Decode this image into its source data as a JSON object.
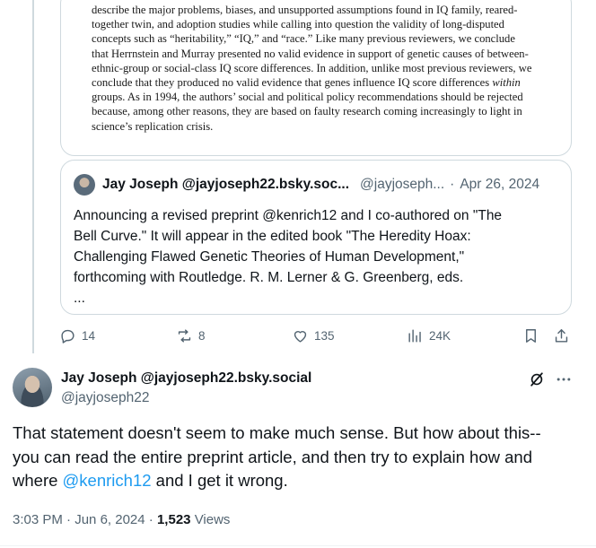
{
  "image_card": {
    "lines": [
      "describe the major problems, biases, and unsupported assumptions found in IQ family, reared-",
      "together twin, and adoption studies while calling into question the validity of long-disputed",
      "concepts such as “heritability,” “IQ,” and “race.” Like many previous reviewers, we conclude",
      "that Herrnstein and Murray presented no valid evidence in support of genetic causes of between-",
      "ethnic-group or social-class IQ score differences. In addition, unlike most previous reviewers, we",
      "conclude that they produced no valid evidence that genes influence IQ score differences",
      "groups. As in 1994, the authors’ social and political policy recommendations should be rejected",
      "because, among other reasons, they are based on faulty research coming increasingly to light in",
      "science’s replication crisis."
    ],
    "italic_word": "within"
  },
  "quote": {
    "author_name": "Jay Joseph @jayjoseph22.bsky.soc...",
    "author_handle": "@jayjoseph...",
    "separator": "·",
    "date": "Apr 26, 2024",
    "body_lines": [
      "Announcing a revised preprint @kenrich12 and I co-authored on \"The",
      "Bell Curve.\" It will appear in the edited book \"The Heredity Hoax:",
      "Challenging Flawed Genetic Theories of Human Development,\"",
      "forthcoming with Routledge. R. M. Lerner & G. Greenberg, eds.",
      "..."
    ]
  },
  "actions": {
    "replies": "14",
    "reposts": "8",
    "likes": "135",
    "views": "24K"
  },
  "post": {
    "author_name": "Jay Joseph @jayjoseph22.bsky.social",
    "author_handle": "@jayjoseph22",
    "text_line1": "That statement doesn't seem to make much sense. But how about this--",
    "text_line2": "you can read the entire preprint article, and then try to explain how and",
    "text_line3_pre": "where ",
    "mention": "@kenrich12",
    "text_line3_post": " and I get it wrong.",
    "time": "3:03 PM",
    "date_sep": "·",
    "date": "Jun 6, 2024",
    "views_count": "1,523",
    "views_label": "Views"
  },
  "colors": {
    "link": "#1d9bf0",
    "secondary_text": "#536471",
    "border": "#cfd9de"
  },
  "icons": [
    "reply-icon",
    "repost-icon",
    "like-icon",
    "views-icon",
    "bookmark-icon",
    "share-icon",
    "grok-icon",
    "more-icon"
  ]
}
